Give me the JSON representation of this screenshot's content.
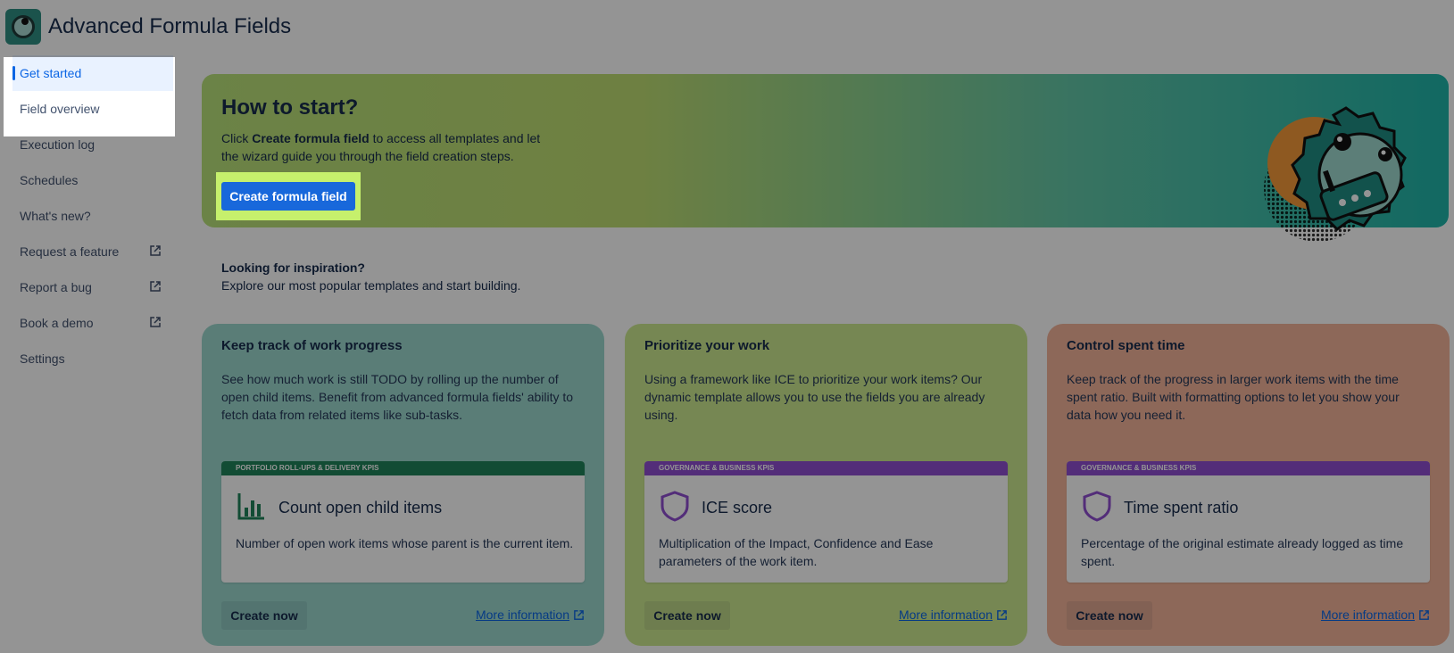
{
  "app": {
    "title": "Advanced Formula Fields",
    "logo_icon": "robot-gear-logo-icon"
  },
  "sidebar": {
    "items": [
      {
        "label": "Get started",
        "active": true
      },
      {
        "label": "Field overview"
      },
      {
        "label": "Execution log"
      },
      {
        "label": "Schedules"
      },
      {
        "label": "What's new?"
      },
      {
        "label": "Request a feature",
        "external": true
      },
      {
        "label": "Report a bug",
        "external": true
      },
      {
        "label": "Book a demo",
        "external": true
      },
      {
        "label": "Settings"
      }
    ]
  },
  "hero": {
    "title": "How to start?",
    "text_prefix": "Click ",
    "text_bold": "Create formula field",
    "text_suffix": " to access all templates and let the wizard guide you through the field creation steps.",
    "button_label": "Create formula field"
  },
  "inspiration": {
    "title": "Looking for inspiration?",
    "subtitle": "Explore our most popular templates and start building."
  },
  "cards": [
    {
      "title": "Keep track of work progress",
      "description": "See how much work is still TODO by rolling up the number of open child items. Benefit from advanced formula fields' ability to fetch data from related items like sub-tasks.",
      "category": "PORTFOLIO ROLL-UPS & DELIVERY KPIS",
      "template_name": "Count open child items",
      "template_desc": "Number of open work items whose parent is the current item.",
      "icon": "bar-chart-icon",
      "create_label": "Create now",
      "more_label": "More information"
    },
    {
      "title": "Prioritize your work",
      "description": "Using a framework like ICE to prioritize your work items? Our dynamic template allows you to use the fields you are already using.",
      "category": "GOVERNANCE & BUSINESS KPIS",
      "template_name": "ICE score",
      "template_desc": "Multiplication of the Impact, Confidence and Ease parameters of the work item.",
      "icon": "shield-icon",
      "create_label": "Create now",
      "more_label": "More information"
    },
    {
      "title": "Control spent time",
      "description": "Keep track of the progress in larger work items with the time spent ratio. Built with formatting options to let you show your data how you need it.",
      "category": "GOVERNANCE & BUSINESS KPIS",
      "template_name": "Time spent ratio",
      "template_desc": "Percentage of the original estimate already logged as time spent.",
      "icon": "shield-icon",
      "create_label": "Create now",
      "more_label": "More information"
    }
  ],
  "colors": {
    "primary": "#1868db",
    "highlight": "#c6f06c",
    "overlay": "rgba(0,0,0,0.42)"
  }
}
